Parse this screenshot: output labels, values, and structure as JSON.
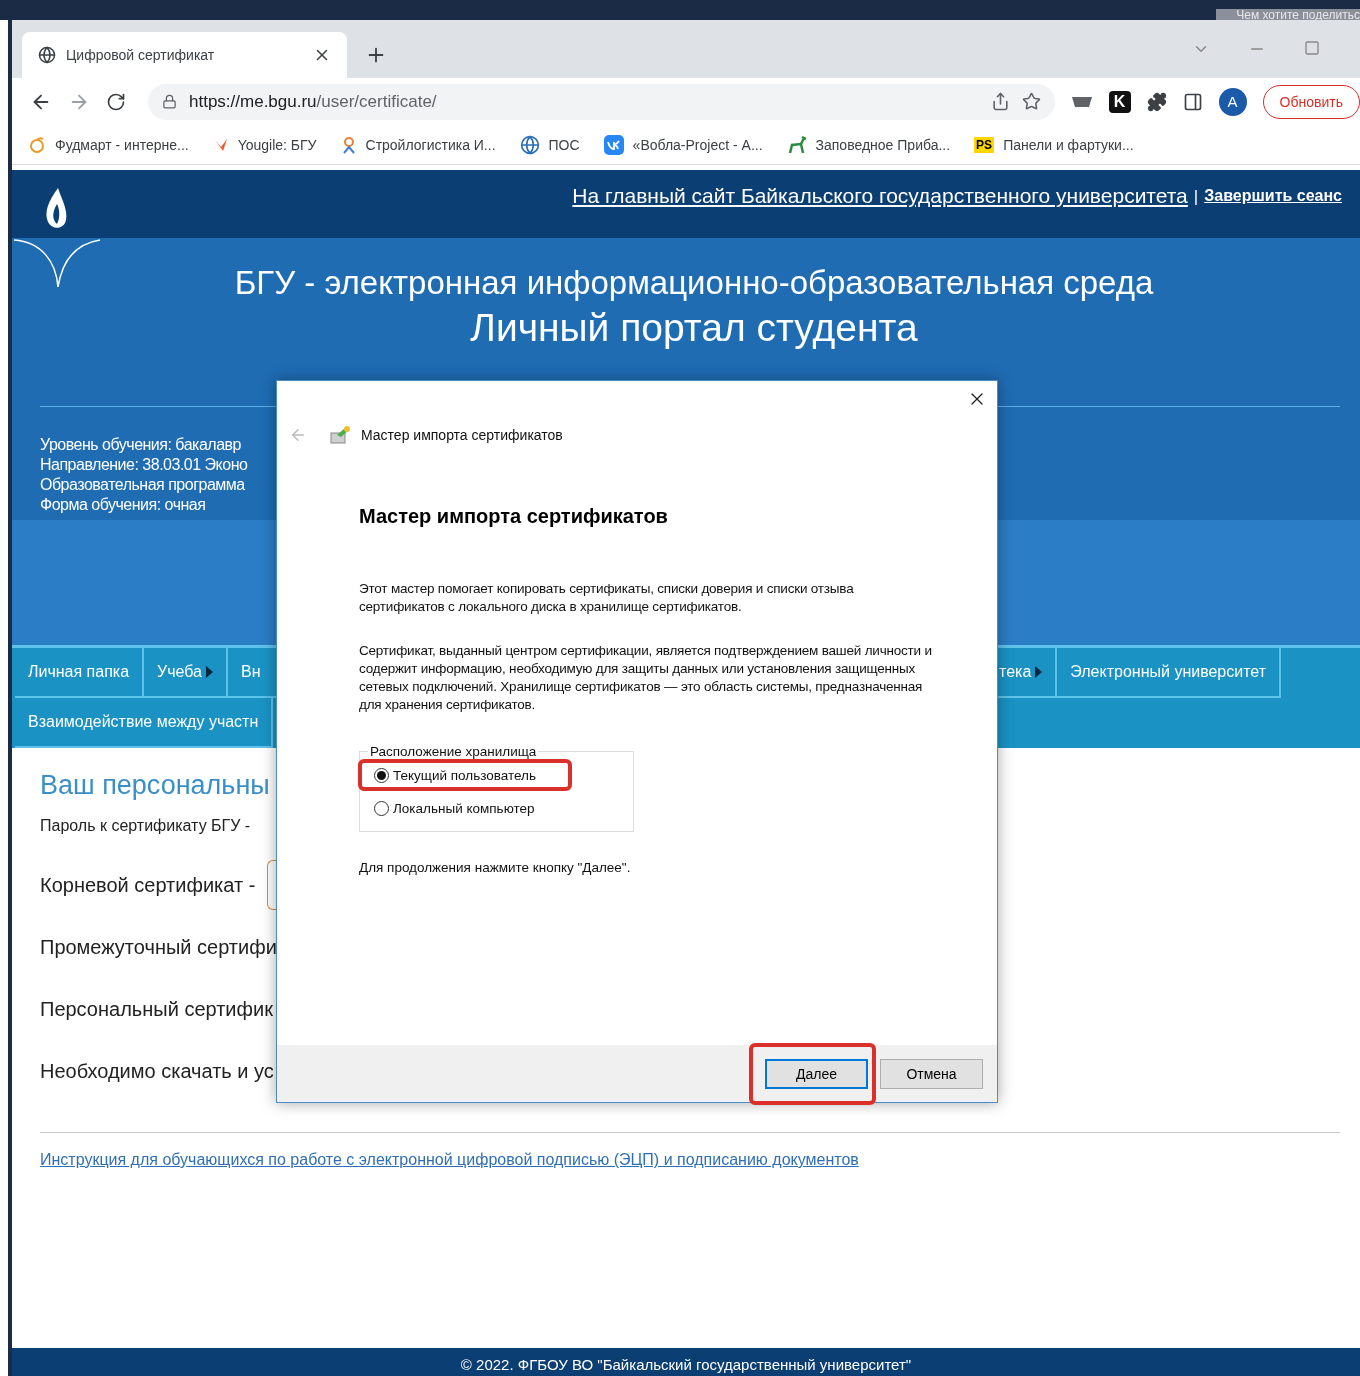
{
  "browser": {
    "share_hint": "Чем хотите поделитьс",
    "tab": {
      "title": "Цифровой сертификат",
      "selected": true
    },
    "url": {
      "host": "https://me.bgu.ru",
      "path": "/user/certificate/"
    },
    "extension_letter": "K",
    "avatar": "A",
    "update_button": "Обновить",
    "bookmarks": [
      {
        "label": "Фудмарт - интерне...",
        "kind": "orange"
      },
      {
        "label": "Yougile: БГУ",
        "kind": "yougile"
      },
      {
        "label": "Стройлогистика И...",
        "kind": "person"
      },
      {
        "label": "ПОС",
        "kind": "globe"
      },
      {
        "label": "«Вобла-Project - А...",
        "kind": "vk"
      },
      {
        "label": "Заповедное Приба...",
        "kind": "deer"
      },
      {
        "label": "Панели и фартуки...",
        "kind": "badge",
        "badge": "PS"
      }
    ]
  },
  "site": {
    "header_link": "На главный сайт Байкальского государственного университета",
    "separator": "|",
    "logout": "Завершить сеанс",
    "title": "БГУ - электронная информационно-образовательная среда",
    "subtitle": "Личный портал студента",
    "student_info": [
      "Уровень обучения: бакалавр",
      "Направление: 38.03.01 Эконо",
      "Образовательная программа",
      "Форма обучения: очная"
    ],
    "nav_rows": [
      [
        {
          "label": "Личная папка",
          "has_arrow": false
        },
        {
          "label": "Учеба",
          "has_arrow": true
        },
        {
          "label": "Вн",
          "has_arrow": false
        },
        {
          "label": "тека",
          "has_arrow": true
        },
        {
          "label": "Электронный университет",
          "has_arrow": false
        }
      ],
      [
        {
          "label": "Взаимодействие между участн",
          "has_arrow": false
        }
      ]
    ],
    "heading": "Ваш персональны",
    "lines": [
      {
        "text": "Пароль к сертификату БГУ -",
        "kind": "small"
      },
      {
        "text": "Корневой сертификат -",
        "kind": "button"
      },
      {
        "text": "Промежуточный сертифи",
        "kind": "large"
      },
      {
        "text": "Персональный сертифик",
        "kind": "large"
      },
      {
        "text": "Необходимо скачать и ус",
        "kind": "large"
      }
    ],
    "instruction_link": "Инструкция для обучающихся по работе с электронной цифровой подписью (ЭЦП) и подписанию документов",
    "footer": "© 2022. ФГБОУ ВО \"Байкальский государственный университет\""
  },
  "dialog": {
    "title": "Мастер импорта сертификатов",
    "heading": "Мастер импорта сертификатов",
    "paragraphs": [
      "Этот мастер помогает копировать сертификаты, списки доверия и списки отзыва сертификатов с локального диска в хранилище сертификатов.",
      "Сертификат, выданный центром сертификации, является подтверждением вашей личности и содержит информацию, необходимую для защиты данных или установления защищенных сетевых подключений. Хранилище сертификатов — это область системы, предназначенная для хранения сертификатов."
    ],
    "group_label": "Расположение хранилища",
    "options": [
      {
        "label": "Текущий пользователь",
        "selected": true,
        "highlighted": true
      },
      {
        "label": "Локальный компьютер",
        "selected": false,
        "highlighted": false
      }
    ],
    "hint": "Для продолжения нажмите кнопку \"Далее\".",
    "buttons": [
      {
        "label": "Далее",
        "default": true,
        "highlighted": true
      },
      {
        "label": "Отмена",
        "default": false,
        "highlighted": false
      }
    ]
  }
}
